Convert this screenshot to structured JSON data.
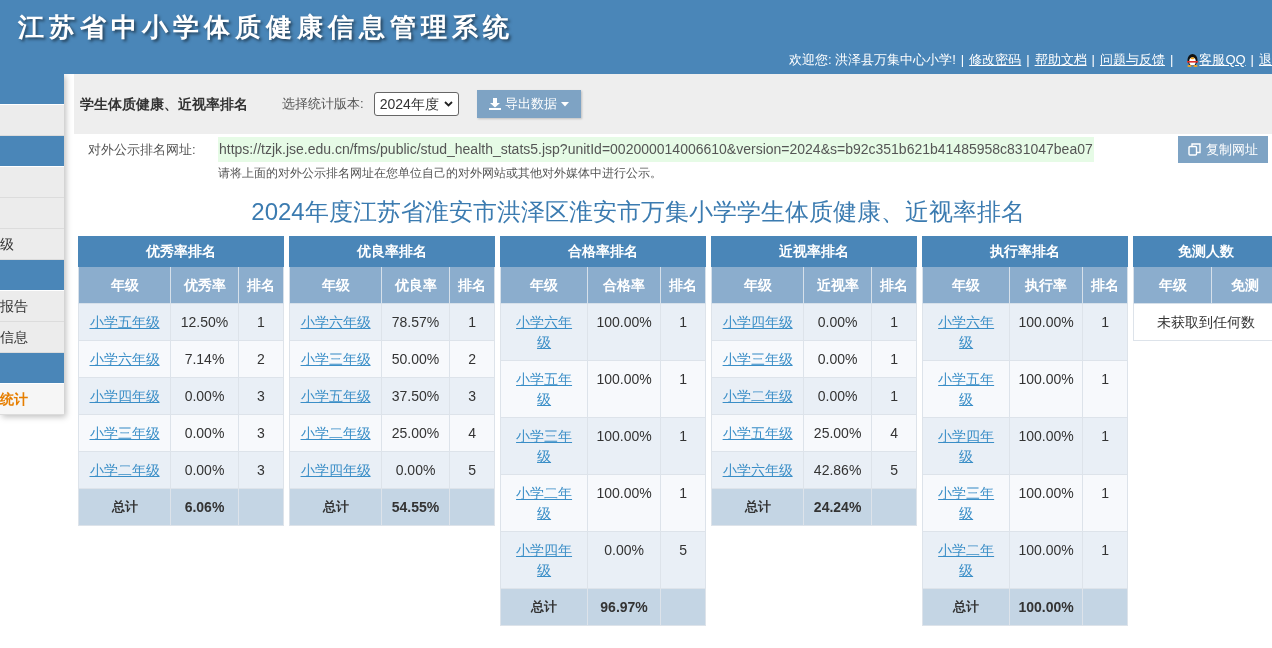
{
  "header": {
    "title": "江苏省中小学体质健康信息管理系统",
    "user_bar": [
      {
        "kind": "text",
        "text": "欢迎您: 洪泽县万集中心小学!"
      },
      {
        "kind": "sep",
        "text": "|"
      },
      {
        "kind": "link",
        "text": "修改密码"
      },
      {
        "kind": "sep",
        "text": "|"
      },
      {
        "kind": "link",
        "text": "帮助文档"
      },
      {
        "kind": "sep",
        "text": "|"
      },
      {
        "kind": "link",
        "text": "问题与反馈"
      },
      {
        "kind": "sep",
        "text": "|"
      },
      {
        "kind": "qq",
        "text": "客服QQ"
      },
      {
        "kind": "sep",
        "text": "|"
      },
      {
        "kind": "link",
        "text": "退"
      }
    ]
  },
  "sidebar": {
    "items": [
      {
        "kind": "header"
      },
      {
        "kind": "item"
      },
      {
        "kind": "header"
      },
      {
        "kind": "item"
      },
      {
        "kind": "item"
      },
      {
        "kind": "item",
        "text": "级",
        "selected": false
      },
      {
        "kind": "header"
      },
      {
        "kind": "item",
        "text": "报告",
        "selected": false
      },
      {
        "kind": "item",
        "text": "信息",
        "selected": false
      },
      {
        "kind": "header"
      },
      {
        "kind": "item",
        "text": "统计",
        "selected": true
      }
    ]
  },
  "toolbar": {
    "title": "学生体质健康、近视率排名",
    "version_label": "选择统计版本:",
    "version_select": {
      "value": "2024年度"
    },
    "export_button": "导出数据"
  },
  "public_url": {
    "label": "对外公示排名网址:",
    "url": "https://tzjk.jse.edu.cn/fms/public/stud_health_stats5.jsp?unitId=002000014006610&version=2024&s=b92c351b621b41485958c831047bea07",
    "copy_button": "复制网址",
    "note": "请将上面的对外公示排名网址在您单位自己的对外网站或其他对外媒体中进行公示。"
  },
  "report_title": "2024年度江苏省淮安市洪泽区淮安市万集小学学生体质健康、近视率排名",
  "tables": [
    {
      "title": "优秀率排名",
      "columns": [
        "年级",
        "优秀率",
        "排名"
      ],
      "rows": [
        {
          "grade": "小学五年级",
          "rate": "12.50%",
          "rank": "1"
        },
        {
          "grade": "小学六年级",
          "rate": "7.14%",
          "rank": "2"
        },
        {
          "grade": "小学四年级",
          "rate": "0.00%",
          "rank": "3"
        },
        {
          "grade": "小学三年级",
          "rate": "0.00%",
          "rank": "3"
        },
        {
          "grade": "小学二年级",
          "rate": "0.00%",
          "rank": "3"
        }
      ],
      "total": {
        "label": "总计",
        "rate": "6.06%"
      }
    },
    {
      "title": "优良率排名",
      "columns": [
        "年级",
        "优良率",
        "排名"
      ],
      "rows": [
        {
          "grade": "小学六年级",
          "rate": "78.57%",
          "rank": "1"
        },
        {
          "grade": "小学三年级",
          "rate": "50.00%",
          "rank": "2"
        },
        {
          "grade": "小学五年级",
          "rate": "37.50%",
          "rank": "3"
        },
        {
          "grade": "小学二年级",
          "rate": "25.00%",
          "rank": "4"
        },
        {
          "grade": "小学四年级",
          "rate": "0.00%",
          "rank": "5"
        }
      ],
      "total": {
        "label": "总计",
        "rate": "54.55%"
      }
    },
    {
      "title": "合格率排名",
      "columns": [
        "年级",
        "合格率",
        "排名"
      ],
      "rows": [
        {
          "grade": "小学六年级",
          "rate": "100.00%",
          "rank": "1"
        },
        {
          "grade": "小学五年级",
          "rate": "100.00%",
          "rank": "1"
        },
        {
          "grade": "小学三年级",
          "rate": "100.00%",
          "rank": "1"
        },
        {
          "grade": "小学二年级",
          "rate": "100.00%",
          "rank": "1"
        },
        {
          "grade": "小学四年级",
          "rate": "0.00%",
          "rank": "5"
        }
      ],
      "total": {
        "label": "总计",
        "rate": "96.97%"
      }
    },
    {
      "title": "近视率排名",
      "columns": [
        "年级",
        "近视率",
        "排名"
      ],
      "rows": [
        {
          "grade": "小学四年级",
          "rate": "0.00%",
          "rank": "1"
        },
        {
          "grade": "小学三年级",
          "rate": "0.00%",
          "rank": "1"
        },
        {
          "grade": "小学二年级",
          "rate": "0.00%",
          "rank": "1"
        },
        {
          "grade": "小学五年级",
          "rate": "25.00%",
          "rank": "4"
        },
        {
          "grade": "小学六年级",
          "rate": "42.86%",
          "rank": "5"
        }
      ],
      "total": {
        "label": "总计",
        "rate": "24.24%"
      }
    },
    {
      "title": "执行率排名",
      "columns": [
        "年级",
        "执行率",
        "排名"
      ],
      "rows": [
        {
          "grade": "小学六年级",
          "rate": "100.00%",
          "rank": "1"
        },
        {
          "grade": "小学五年级",
          "rate": "100.00%",
          "rank": "1"
        },
        {
          "grade": "小学四年级",
          "rate": "100.00%",
          "rank": "1"
        },
        {
          "grade": "小学三年级",
          "rate": "100.00%",
          "rank": "1"
        },
        {
          "grade": "小学二年级",
          "rate": "100.00%",
          "rank": "1"
        }
      ],
      "total": {
        "label": "总计",
        "rate": "100.00%"
      }
    },
    {
      "title": "免测人数",
      "columns": [
        "年级",
        "免测"
      ],
      "empty_message": "未获取到任何数"
    }
  ]
}
